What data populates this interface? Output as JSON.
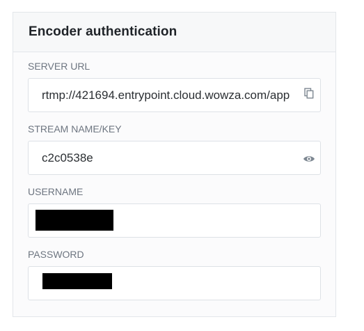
{
  "panel": {
    "title": "Encoder authentication"
  },
  "fields": {
    "server_url": {
      "label": "SERVER URL",
      "value": "rtmp://421694.entrypoint.cloud.wowza.com/app",
      "icon": "copy-icon"
    },
    "stream_key": {
      "label": "STREAM NAME/KEY",
      "value": "c2c0538e",
      "icon": "eye-icon"
    },
    "username": {
      "label": "USERNAME",
      "value": ""
    },
    "password": {
      "label": "PASSWORD",
      "value": ""
    }
  },
  "colors": {
    "label": "#6d7580",
    "title": "#1f2328",
    "border": "#e3e6ea",
    "icon": "#7d8791"
  }
}
